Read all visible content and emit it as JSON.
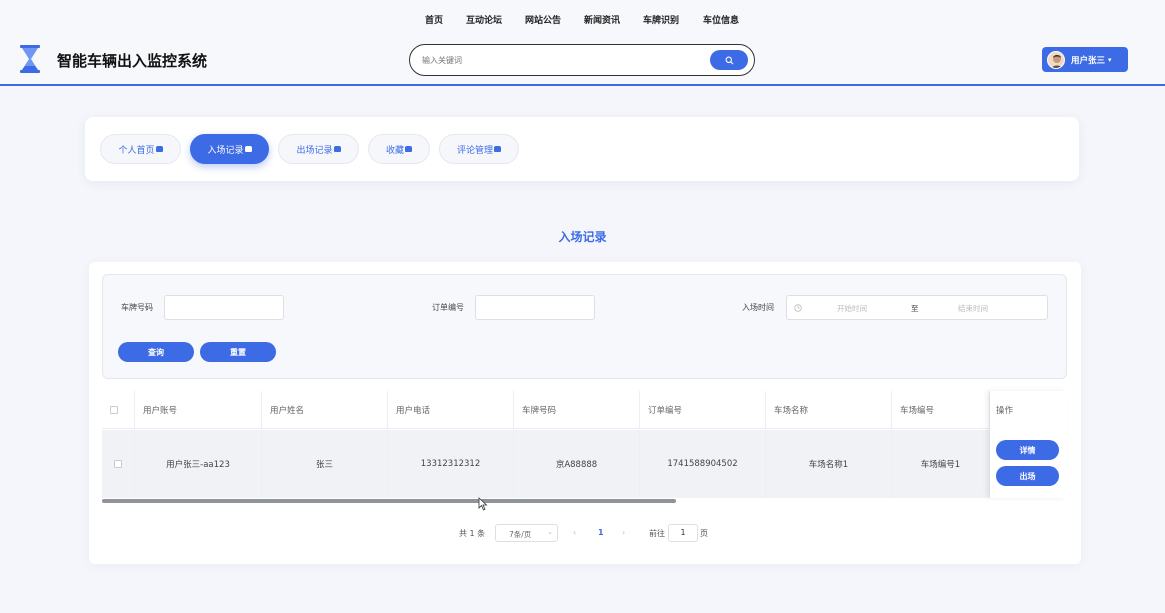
{
  "header": {
    "nav": [
      "首页",
      "互动论坛",
      "网站公告",
      "新闻资讯",
      "车牌识别",
      "车位信息"
    ],
    "site_title": "智能车辆出入监控系统",
    "search": {
      "placeholder": "输入关键词",
      "icon": "search-icon"
    },
    "user": {
      "name": "用户张三",
      "avatar": "avatar-icon"
    }
  },
  "tabs": [
    {
      "label": "个人首页",
      "active": false
    },
    {
      "label": "入场记录",
      "active": true
    },
    {
      "label": "出场记录",
      "active": false
    },
    {
      "label": "收藏",
      "active": false
    },
    {
      "label": "评论管理",
      "active": false
    }
  ],
  "page_title": "入场记录",
  "filters": {
    "plate_label": "车牌号码",
    "plate_value": "",
    "order_label": "订单编号",
    "order_value": "",
    "time_label": "入场时间",
    "start_placeholder": "开始时间",
    "range_sep": "至",
    "end_placeholder": "结束时间",
    "search_btn": "查询",
    "reset_btn": "重置"
  },
  "table": {
    "columns": [
      "用户账号",
      "用户姓名",
      "用户电话",
      "车牌号码",
      "订单编号",
      "车场名称",
      "车场编号"
    ],
    "op_header": "操作",
    "rows": [
      {
        "cells": [
          "用户张三-aa123",
          "张三",
          "13312312312",
          "京A88888",
          "1741588904502",
          "车场名称1",
          "车场编号1"
        ],
        "actions": [
          "详情",
          "出场"
        ]
      }
    ]
  },
  "pagination": {
    "total": "共 1 条",
    "page_size": "7条/页",
    "current": "1",
    "goto_label": "前往",
    "goto_value": "1",
    "page_unit": "页"
  },
  "colors": {
    "accent": "#3d6be6"
  }
}
